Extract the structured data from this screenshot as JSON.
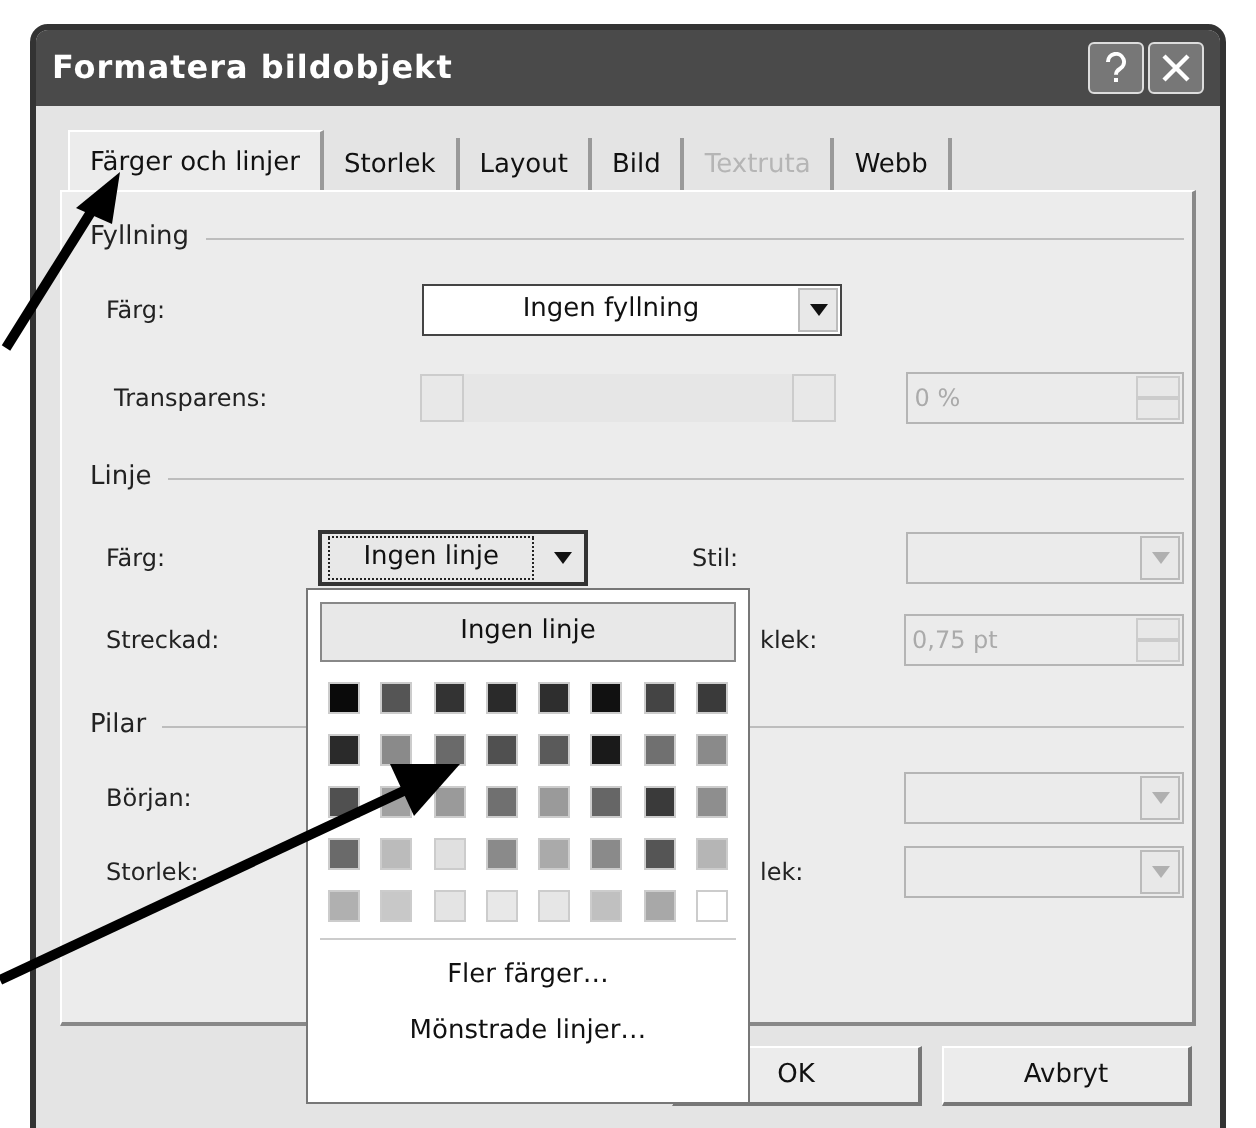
{
  "window": {
    "title": "Formatera bildobjekt"
  },
  "tabs": [
    {
      "label": "Färger och linjer",
      "selected": true,
      "disabled": false
    },
    {
      "label": "Storlek",
      "selected": false,
      "disabled": false
    },
    {
      "label": "Layout",
      "selected": false,
      "disabled": false
    },
    {
      "label": "Bild",
      "selected": false,
      "disabled": false
    },
    {
      "label": "Textruta",
      "selected": false,
      "disabled": true
    },
    {
      "label": "Webb",
      "selected": false,
      "disabled": false
    }
  ],
  "fill": {
    "group": "Fyllning",
    "color_label": "Färg:",
    "color_value": "Ingen fyllning",
    "transparency_label": "Transparens:",
    "transparency_value": "0 %",
    "transparency_disabled": true
  },
  "line": {
    "group": "Linje",
    "color_label": "Färg:",
    "color_value": "Ingen linje",
    "style_label": "Stil:",
    "style_disabled": true,
    "dashed_label": "Streckad:",
    "weight_label": "klek:",
    "weight_value": "0,75 pt",
    "weight_disabled": true
  },
  "arrows": {
    "group": "Pilar",
    "begin_label": "Början:",
    "begin_disabled": true,
    "size_label": "Storlek:",
    "end_size_label": "lek:",
    "end_size_disabled": true
  },
  "color_popup": {
    "none_button": "Ingen linje",
    "swatches": [
      {
        "color": "#0a0a0a"
      },
      {
        "color": "#555555"
      },
      {
        "color": "#333333"
      },
      {
        "color": "#2a2a2a"
      },
      {
        "color": "#2e2e2e"
      },
      {
        "color": "#111111"
      },
      {
        "color": "#444444"
      },
      {
        "color": "#3a3a3a"
      },
      {
        "color": "#2a2a2a"
      },
      {
        "color": "#8a8a8a"
      },
      {
        "color": "#6a6a6a"
      },
      {
        "color": "#505050"
      },
      {
        "color": "#5a5a5a"
      },
      {
        "color": "#1a1a1a"
      },
      {
        "color": "#707070"
      },
      {
        "color": "#8a8a8a"
      },
      {
        "color": "#505050"
      },
      {
        "color": "#a0a0a0"
      },
      {
        "color": "#9a9a9a"
      },
      {
        "color": "#707070"
      },
      {
        "color": "#9a9a9a"
      },
      {
        "color": "#666666"
      },
      {
        "color": "#3a3a3a"
      },
      {
        "color": "#8e8e8e"
      },
      {
        "color": "#6a6a6a"
      },
      {
        "color": "#bbbbbb"
      },
      {
        "color": "#e0e0e0"
      },
      {
        "color": "#8a8a8a"
      },
      {
        "color": "#aaaaaa"
      },
      {
        "color": "#8a8a8a"
      },
      {
        "color": "#555555"
      },
      {
        "color": "#b5b5b5"
      },
      {
        "color": "#b0b0b0"
      },
      {
        "color": "#c8c8c8"
      },
      {
        "color": "#e4e4e4"
      },
      {
        "color": "#e8e8e8"
      },
      {
        "color": "#e6e6e6"
      },
      {
        "color": "#c0c0c0"
      },
      {
        "color": "#a8a8a8"
      },
      {
        "color": "#ffffff"
      }
    ],
    "links": [
      "Fler färger…",
      "Mönstrade linjer…"
    ]
  },
  "buttons": [
    {
      "label": "OK"
    },
    {
      "label": "Avbryt"
    }
  ]
}
